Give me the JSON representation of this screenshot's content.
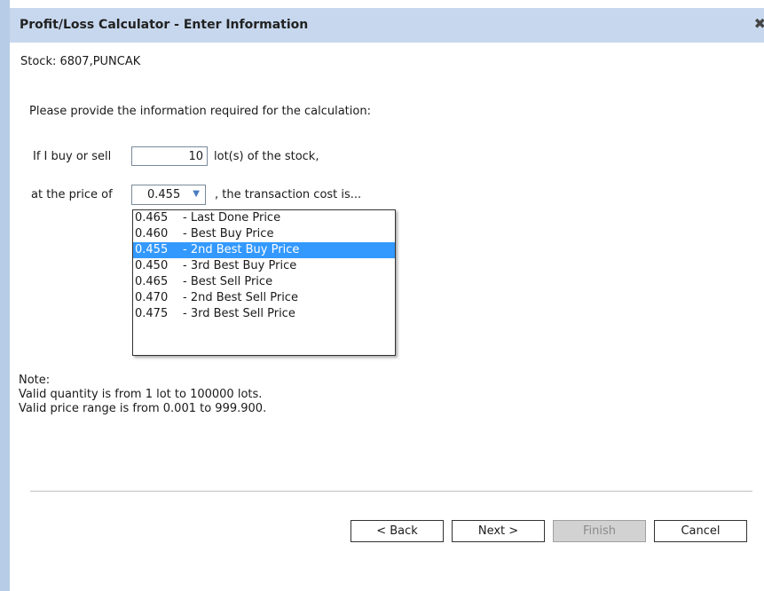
{
  "window": {
    "title": "Profit/Loss Calculator - Enter Information",
    "close_symbol": "✖"
  },
  "stock": {
    "line": "Stock: 6807,PUNCAK"
  },
  "intro": "Please provide the information required for the calculation:",
  "quantity": {
    "label": "If I buy or sell",
    "value": "10",
    "suffix": "lot(s) of the stock,"
  },
  "price": {
    "label": "at the price of",
    "selected": "0.455",
    "suffix": ", the transaction cost is...",
    "options": [
      {
        "price": "0.465",
        "desc": "- Last Done Price"
      },
      {
        "price": "0.460",
        "desc": "- Best Buy Price"
      },
      {
        "price": "0.455",
        "desc": "- 2nd Best Buy Price"
      },
      {
        "price": "0.450",
        "desc": "- 3rd Best Buy Price"
      },
      {
        "price": "0.465",
        "desc": "- Best Sell Price"
      },
      {
        "price": "0.470",
        "desc": "- 2nd Best Sell Price"
      },
      {
        "price": "0.475",
        "desc": "- 3rd Best Sell Price"
      }
    ],
    "selected_index": 2
  },
  "note": {
    "heading": "Note:",
    "line1": "Valid quantity is from 1 lot to 100000 lots.",
    "line2": "Valid price range is from 0.001 to 999.900."
  },
  "buttons": {
    "back": "< Back",
    "next": "Next >",
    "finish": "Finish",
    "cancel": "Cancel"
  },
  "colors": {
    "title_bar": "#c7d8ee",
    "selection": "#3399ff",
    "disabled_button": "#d2d2d2"
  }
}
